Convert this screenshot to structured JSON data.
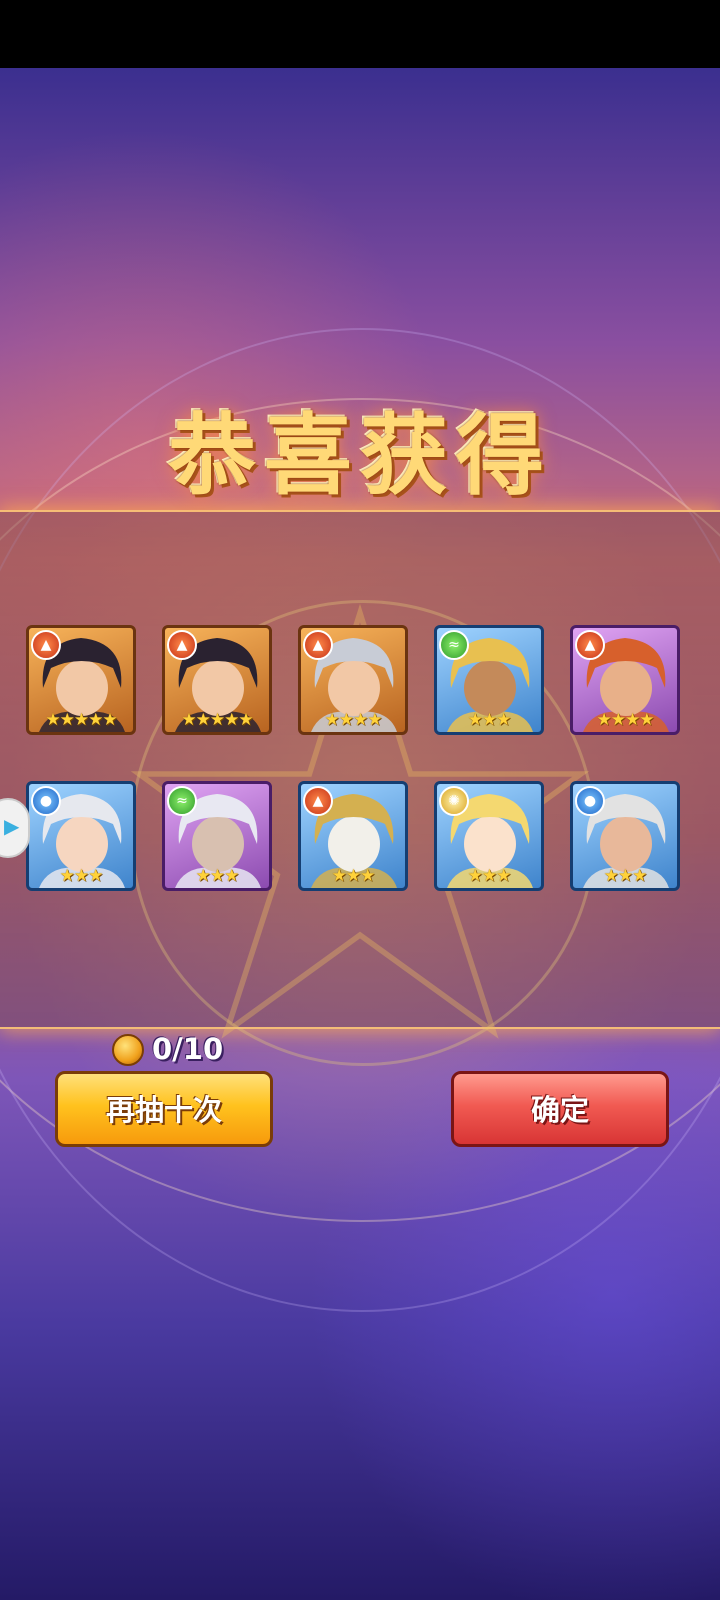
{
  "title": "恭喜获得",
  "heroes": [
    {
      "element": "fire",
      "rarity": "orange",
      "stars": 5,
      "star_text": "★★★★★",
      "portrait": "black-haired-swordsman"
    },
    {
      "element": "fire",
      "rarity": "orange",
      "stars": 5,
      "star_text": "★★★★★",
      "portrait": "black-haired-swordsman"
    },
    {
      "element": "fire",
      "rarity": "orange",
      "stars": 4,
      "star_text": "★★★★",
      "portrait": "silver-haired-warrior"
    },
    {
      "element": "wind",
      "rarity": "blue",
      "stars": 3,
      "star_text": "★★★",
      "portrait": "eagle-helm-fighter"
    },
    {
      "element": "fire",
      "rarity": "purple",
      "stars": 4,
      "star_text": "★★★★",
      "portrait": "red-bearded-dwarf"
    },
    {
      "element": "water",
      "rarity": "blue",
      "stars": 3,
      "star_text": "★★★",
      "portrait": "white-haired-elf-girl"
    },
    {
      "element": "wind",
      "rarity": "purple",
      "stars": 3,
      "star_text": "★★★",
      "portrait": "old-wizard"
    },
    {
      "element": "fire",
      "rarity": "blue",
      "stars": 3,
      "star_text": "★★★",
      "portrait": "horned-helm-dwarf"
    },
    {
      "element": "light",
      "rarity": "blue",
      "stars": 3,
      "star_text": "★★★",
      "portrait": "blonde-fairy-girl"
    },
    {
      "element": "water",
      "rarity": "blue",
      "stars": 3,
      "star_text": "★★★",
      "portrait": "long-haired-elf"
    }
  ],
  "element_icons": {
    "fire": "flame-icon",
    "wind": "wind-icon",
    "water": "water-drop-icon",
    "light": "sun-icon"
  },
  "counter": {
    "value": "0/10",
    "icon": "gold-coin-icon"
  },
  "buttons": {
    "draw_again": "再抽十次",
    "confirm": "确定"
  },
  "colors": {
    "title": "#ffd977",
    "draw_again_button": "#ffc21e",
    "confirm_button": "#f15a52",
    "frame_orange": "#f7b35a",
    "frame_blue": "#3f84cc",
    "frame_purple": "#8c4bb0"
  }
}
